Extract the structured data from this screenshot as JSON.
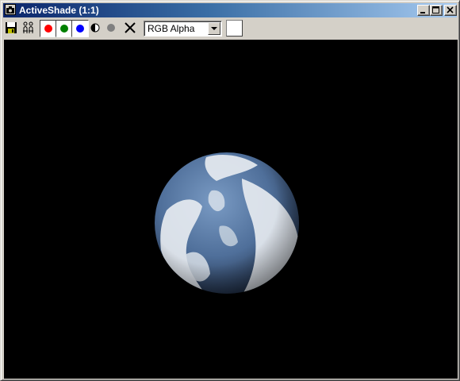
{
  "window": {
    "title": "ActiveShade (1:1)",
    "app_icon": "camera-icon",
    "controls": [
      "minimize-icon",
      "maximize-icon",
      "close-icon"
    ]
  },
  "toolbar": {
    "tools": [
      {
        "name": "save-image",
        "icon": "floppy-disk-icon"
      },
      {
        "name": "clone",
        "icon": "clone-icon"
      },
      {
        "name": "red-channel",
        "icon": "red-dot-icon",
        "color": "#ff0000",
        "pressed": true
      },
      {
        "name": "green-channel",
        "icon": "green-dot-icon",
        "color": "#008000",
        "pressed": true
      },
      {
        "name": "blue-channel",
        "icon": "blue-dot-icon",
        "color": "#0000ff",
        "pressed": true
      },
      {
        "name": "monochrome",
        "icon": "half-circle-icon"
      },
      {
        "name": "alpha-channel",
        "icon": "gray-dot-icon",
        "color": "#808080"
      },
      {
        "name": "clear",
        "icon": "x-icon"
      }
    ],
    "channel_select": {
      "value": "RGB Alpha"
    },
    "swatch_color": "#ffffff"
  },
  "viewport": {
    "background": "#000000",
    "content": "planet-render"
  }
}
